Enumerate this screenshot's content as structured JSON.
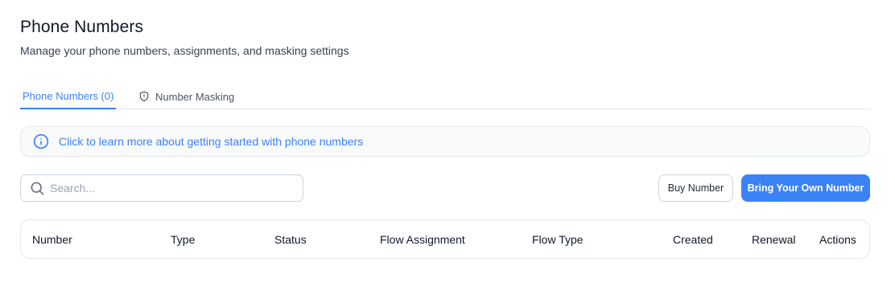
{
  "header": {
    "title": "Phone Numbers",
    "subtitle": "Manage your phone numbers, assignments, and masking settings"
  },
  "tabs": [
    {
      "label": "Phone Numbers (0)",
      "active": true
    },
    {
      "label": "Number Masking",
      "active": false,
      "icon": "shield-icon"
    }
  ],
  "info_banner": {
    "icon": "info-icon",
    "text": "Click to learn more about getting started with phone numbers"
  },
  "search": {
    "icon": "search-icon",
    "placeholder": "Search...",
    "value": ""
  },
  "actions": {
    "buy_label": "Buy Number",
    "byon_label": "Bring Your Own Number"
  },
  "table": {
    "columns": [
      "Number",
      "Type",
      "Status",
      "Flow Assignment",
      "Flow Type",
      "Created",
      "Renewal",
      "Actions"
    ]
  },
  "colors": {
    "accent": "#3b82f6",
    "text": "#111827",
    "border": "#e5e7eb"
  }
}
